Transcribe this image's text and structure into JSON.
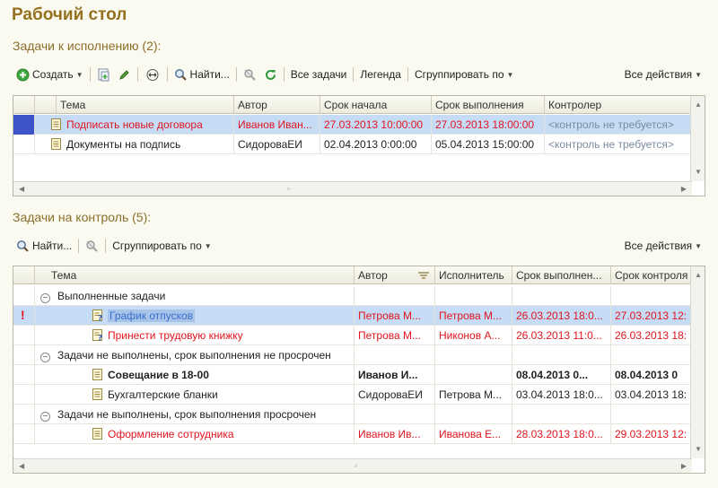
{
  "page_title": "Рабочий стол",
  "section1": {
    "title": "Задачи к исполнению (2):",
    "toolbar": {
      "create": "Создать",
      "find": "Найти...",
      "all_tasks": "Все задачи",
      "legend": "Легенда",
      "group_by": "Сгруппировать по",
      "all_actions": "Все действия"
    },
    "columns": [
      "Тема",
      "Автор",
      "Срок начала",
      "Срок выполнения",
      "Контролер"
    ],
    "rows": [
      {
        "theme": "Подписать новые договора",
        "author": "Иванов Иван...",
        "start": "27.03.2013 10:00:00",
        "due": "27.03.2013 18:00:00",
        "controller": "<контроль не требуется>"
      },
      {
        "theme": "Документы на подпись",
        "author": "СидороваЕИ",
        "start": "02.04.2013 0:00:00",
        "due": "05.04.2013 15:00:00",
        "controller": "<контроль не требуется>"
      }
    ]
  },
  "section2": {
    "title": "Задачи на контроль (5):",
    "toolbar": {
      "find": "Найти...",
      "group_by": "Сгруппировать по",
      "all_actions": "Все действия"
    },
    "columns": [
      "Тема",
      "Автор",
      "Исполнитель",
      "Срок выполнен...",
      "Срок контроля"
    ],
    "groups": [
      {
        "label": "Выполненные задачи",
        "rows": [
          {
            "theme": "График отпусков",
            "author": "Петрова М...",
            "executor": "Петрова М...",
            "due": "26.03.2013 18:0...",
            "control": "27.03.2013 12:"
          },
          {
            "theme": "Принести трудовую книжку",
            "author": "Петрова М...",
            "executor": "Никонов А...",
            "due": "26.03.2013 11:0...",
            "control": "26.03.2013 18:"
          }
        ]
      },
      {
        "label": "Задачи не выполнены, срок выполнения не просрочен",
        "rows": [
          {
            "theme": "Совещание в 18-00",
            "author": "Иванов И...",
            "executor": "",
            "due": "08.04.2013 0...",
            "control": "08.04.2013 0"
          },
          {
            "theme": "Бухгалтерские бланки",
            "author": "СидороваЕИ",
            "executor": "Петрова М...",
            "due": "03.04.2013 18:0...",
            "control": "03.04.2013 18:"
          }
        ]
      },
      {
        "label": "Задачи не выполнены, срок выполнения просрочен",
        "rows": [
          {
            "theme": "Оформление сотрудника",
            "author": "Иванов Ив...",
            "executor": "Иванова Е...",
            "due": "28.03.2013 18:0...",
            "control": "29.03.2013 12:"
          }
        ]
      }
    ]
  },
  "colors": {
    "title": "#94711f",
    "overdue_text": "#e0141e",
    "selection": "#c6dcf5",
    "marker": "#3c54c8"
  }
}
